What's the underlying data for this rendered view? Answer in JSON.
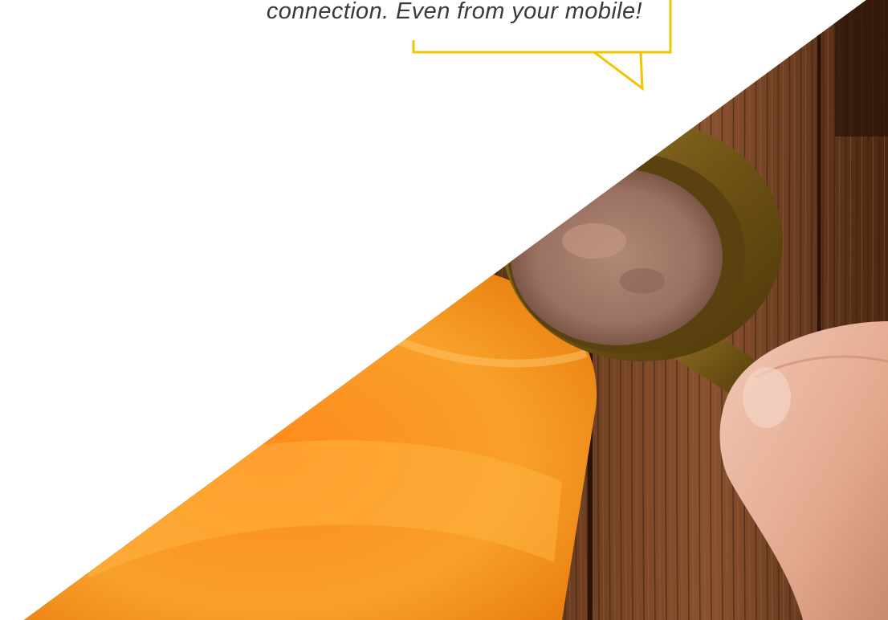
{
  "callout": {
    "text": "connection. Even from your mobile!",
    "border_color": "#f2c500"
  },
  "hero_image": {
    "subject": "hand-scooping-protein-powder-into-orange-shaker",
    "colors": {
      "wood": "#6b3a1e",
      "shaker": "#f5961e",
      "powder": "#a47a66",
      "scoop": "#7d5d1e",
      "skin": "#e8b9a3"
    }
  }
}
